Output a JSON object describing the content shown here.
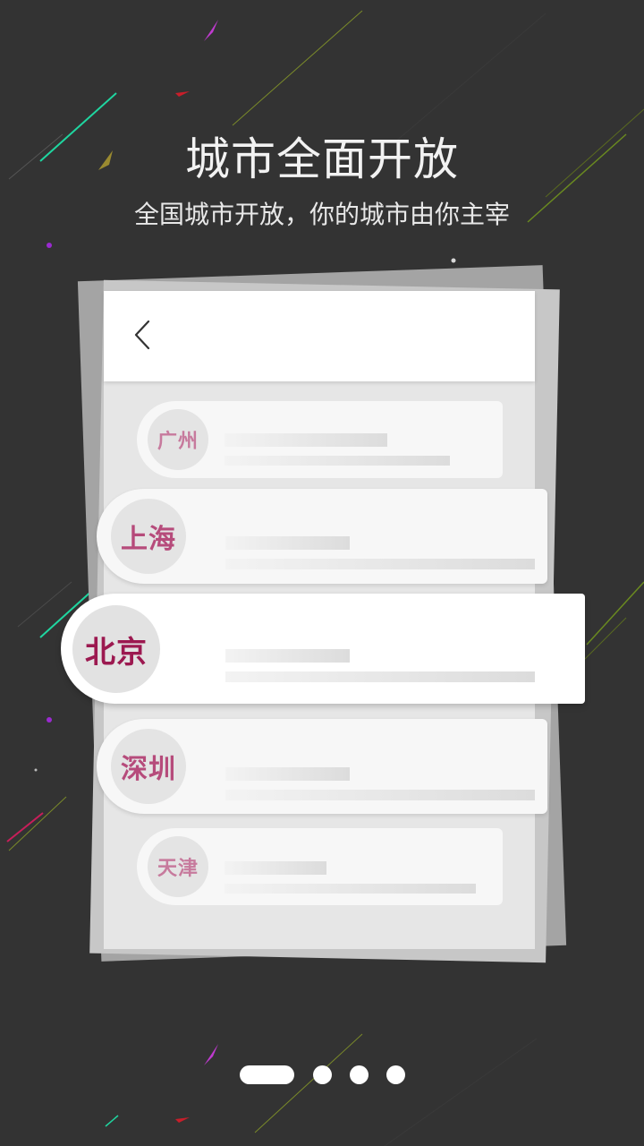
{
  "header": {
    "title": "城市全面开放",
    "subtitle": "全国城市开放，你的城市由你主宰"
  },
  "card": {
    "back_icon": "chevron-left-icon",
    "cities": [
      {
        "name": "广州"
      },
      {
        "name": "上海"
      },
      {
        "name": "北京"
      },
      {
        "name": "深圳"
      },
      {
        "name": "天津"
      }
    ]
  },
  "pager": {
    "total_pages": 4,
    "current_page": 1
  },
  "colors": {
    "background": "#333333",
    "accent_city": "#9c1950"
  }
}
